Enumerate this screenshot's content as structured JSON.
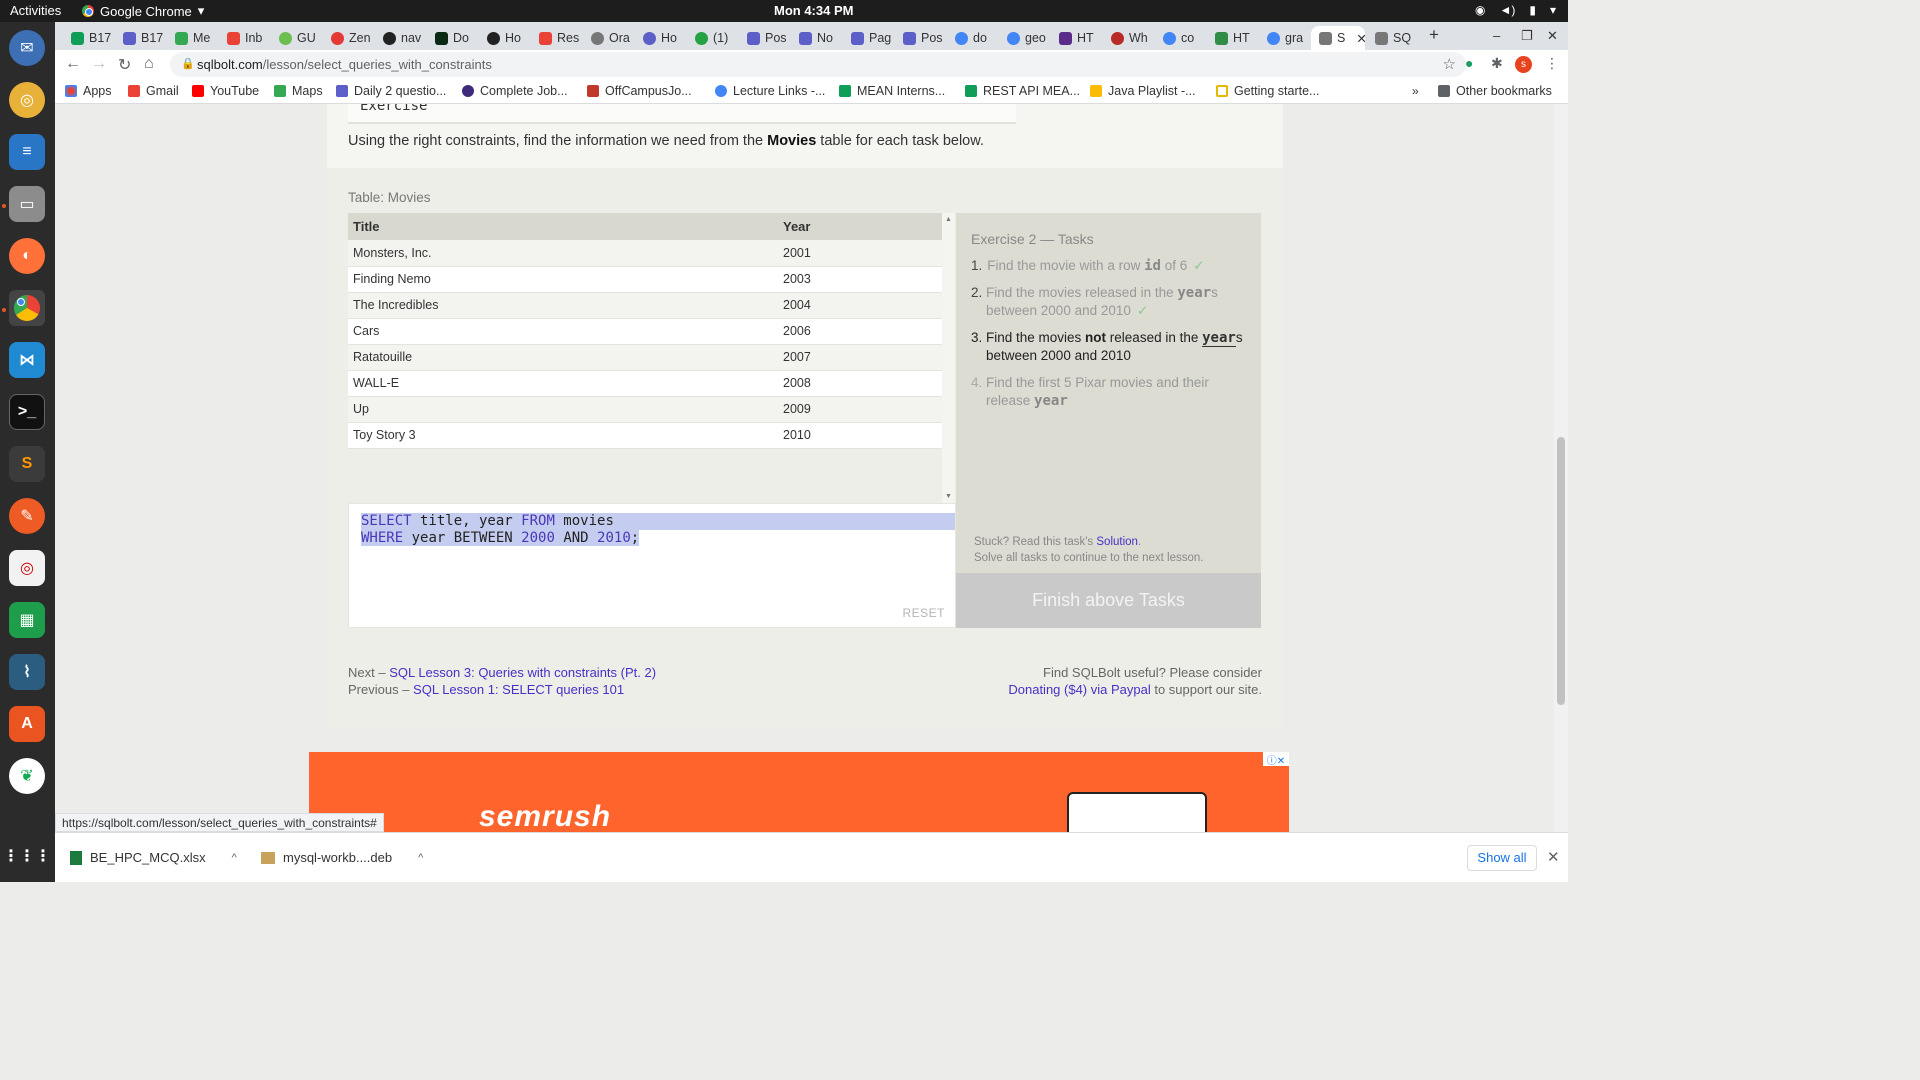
{
  "system": {
    "activities": "Activities",
    "app_name": "Google Chrome",
    "clock": "Mon  4:34 PM"
  },
  "tabs": [
    "B17",
    "B17",
    "Me",
    "Inb",
    "GU",
    "Zen",
    "nav",
    "Do",
    "Ho",
    "Res",
    "Ora",
    "Ho",
    "(1) ",
    "Pos",
    "No",
    "Pag",
    "Pos",
    "do",
    "geo",
    "HT",
    "Wh",
    "co",
    "HT",
    "gra",
    "S",
    "SQ"
  ],
  "omnibox": {
    "host": "sqlbolt.com",
    "path": "/lesson/select_queries_with_constraints"
  },
  "bookmarks": [
    "Apps",
    "Gmail",
    "YouTube",
    "Maps",
    "Daily 2 questio...",
    "Complete Job...",
    "OffCampusJo...",
    "Lecture Links -...",
    "MEAN Interns...",
    "REST API MEA...",
    "Java Playlist -...",
    "Getting starte...",
    "Other bookmarks"
  ],
  "page": {
    "exercise_heading": "Exercise",
    "intro_pre": "Using the right constraints, find the information we need from the ",
    "intro_bold": "Movies",
    "intro_post": " table for each task below.",
    "table_caption": "Table: Movies",
    "columns": [
      "Title",
      "Year"
    ],
    "rows": [
      {
        "title": "Monsters, Inc.",
        "year": "2001"
      },
      {
        "title": "Finding Nemo",
        "year": "2003"
      },
      {
        "title": "The Incredibles",
        "year": "2004"
      },
      {
        "title": "Cars",
        "year": "2006"
      },
      {
        "title": "Ratatouille",
        "year": "2007"
      },
      {
        "title": "WALL-E",
        "year": "2008"
      },
      {
        "title": "Up",
        "year": "2009"
      },
      {
        "title": "Toy Story 3",
        "year": "2010"
      }
    ],
    "query": {
      "kw_select": "SELECT",
      "line1_rest": " title, year ",
      "kw_from": "FROM",
      "line1_table": " movies",
      "kw_where": "WHERE",
      "line2_a": " year BETWEEN ",
      "num_a": "2000",
      "kw_and": " AND ",
      "num_b": "2010",
      "line2_end": ";"
    },
    "reset_label": "RESET",
    "tasks_title": "Exercise 2 — Tasks",
    "tasks": [
      {
        "n": "1.",
        "pre": "Find the movie with a row ",
        "code": "id",
        "post": " of 6",
        "done": "✓"
      },
      {
        "n": "2.",
        "pre": "Find the movies released in the ",
        "code": "year",
        "post": "s between 2000 and 2010",
        "done": "✓"
      },
      {
        "n": "3.",
        "pre": "Find the movies ",
        "bold": "not",
        "mid": " released in the ",
        "code": "year",
        "post": "s between 2000 and 2010"
      },
      {
        "n": "4.",
        "pre": "Find the first 5 Pixar movies and their release ",
        "code": "year"
      }
    ],
    "hint_pre": "Stuck? Read this task's ",
    "hint_link": "Solution",
    "hint_post": ".",
    "hint_line2": "Solve all tasks to continue to the next lesson.",
    "finish_label": "Finish above Tasks",
    "next_prefix": "Next – ",
    "next_link": "SQL Lesson 3: Queries with constraints (Pt. 2)",
    "prev_prefix": "Previous – ",
    "prev_link": "SQL Lesson 1: SELECT queries 101",
    "support_line1": "Find SQLBolt useful? Please consider",
    "support_link": "Donating ($4) via Paypal",
    "support_post": " to support our site.",
    "ad_brand": "semrush"
  },
  "status_url": "https://sqlbolt.com/lesson/select_queries_with_constraints#",
  "downloads": {
    "items": [
      "BE_HPC_MCQ.xlsx",
      "mysql-workb....deb"
    ],
    "show_all": "Show all"
  },
  "colors": {
    "accent_link": "#4630c8",
    "ad_orange": "#ff642d",
    "dock_bg": "#2b2b2b"
  }
}
